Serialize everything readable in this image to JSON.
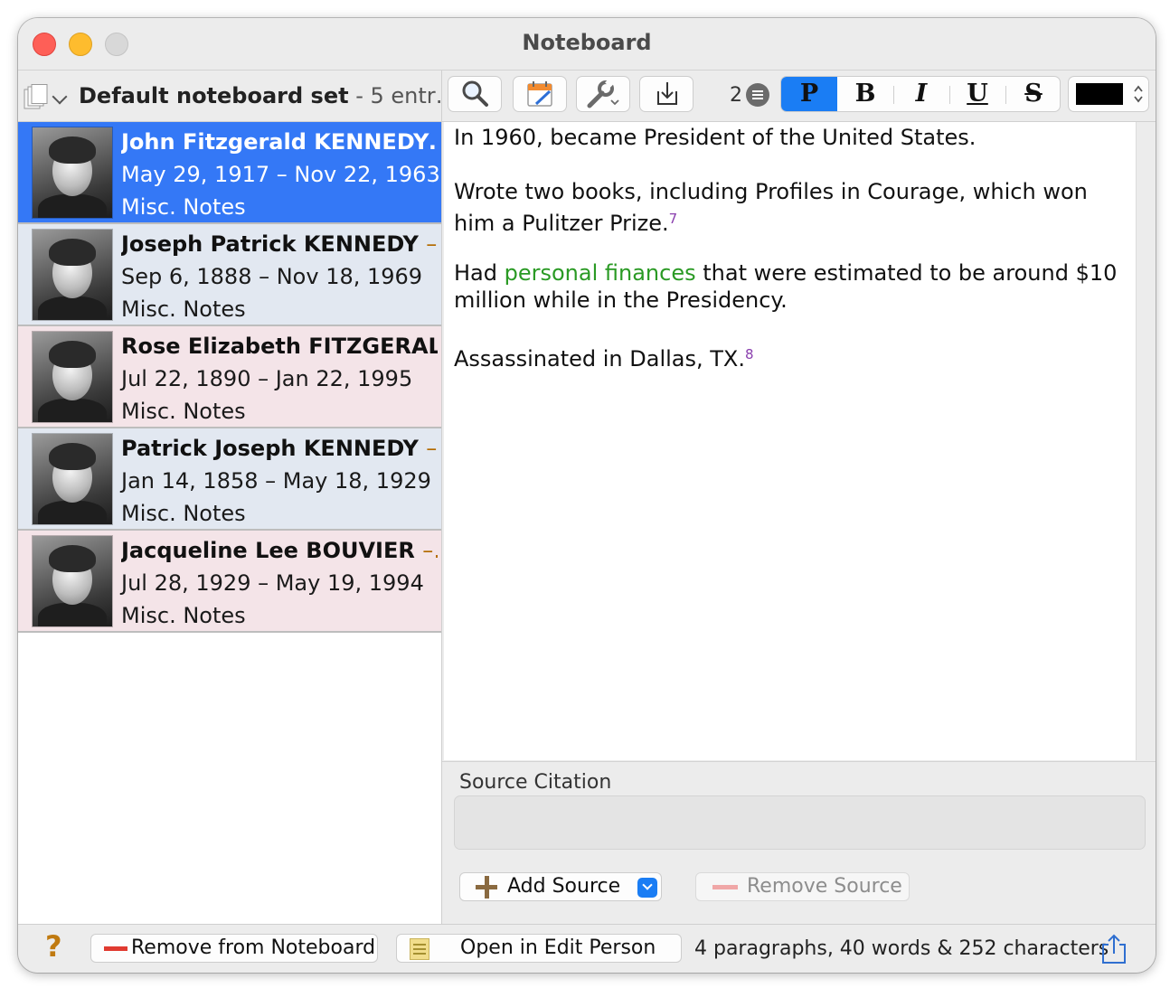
{
  "window": {
    "title": "Noteboard"
  },
  "noteboard_set": {
    "name": "Default noteboard set",
    "count": " - 5 entr…"
  },
  "people": [
    {
      "name": "John Fitzgerald KENNEDY…",
      "dash": "",
      "dates": "May 29, 1917 – Nov 22, 1963",
      "notes": "Misc. Notes",
      "style": "selected"
    },
    {
      "name": "Joseph Patrick KENNEDY ",
      "dash": "–…",
      "dates": "Sep 6, 1888 – Nov 18, 1969",
      "notes": "Misc. Notes",
      "style": "blue"
    },
    {
      "name": "Rose Elizabeth FITZGERAL…",
      "dash": "",
      "dates": "Jul 22, 1890 – Jan 22, 1995",
      "notes": "Misc. Notes",
      "style": "pink"
    },
    {
      "name": "Patrick Joseph KENNEDY ",
      "dash": "–…",
      "dates": "Jan 14, 1858 – May 18, 1929",
      "notes": "Misc. Notes",
      "style": "blue"
    },
    {
      "name": "Jacqueline Lee BOUVIER ",
      "dash": "–…",
      "dates": "Jul 28, 1929 – May 19, 1994",
      "notes": "Misc. Notes",
      "style": "pink"
    }
  ],
  "toolbar": {
    "paragraph_count": "2",
    "format_buttons": [
      "P",
      "B",
      "I",
      "U",
      "S"
    ],
    "text_color": "#000000"
  },
  "note": {
    "p1": "In 1960, became President of the United States.",
    "p2": "Wrote two books, including Profiles in Courage, which won him a Pulitzer Prize.",
    "p2_footnote": "7",
    "p3_before": "Had ",
    "p3_link": "personal finances",
    "p3_after": " that were estimated to be around $10 million while in the Presidency.",
    "p4": "Assassinated in Dallas, TX.",
    "p4_footnote": "8"
  },
  "citation": {
    "label": "Source Citation",
    "add_source": "Add Source",
    "remove_source": "Remove Source"
  },
  "bottom": {
    "help": "?",
    "remove_label": "Remove from Noteboard",
    "open_label": "Open in Edit Person",
    "stats": "4 paragraphs, 40 words & 252 characters"
  },
  "colors": {
    "accent": "#1a7df4",
    "selected_row": "#3478f6",
    "link_green": "#2a9a24",
    "footnote": "#8a3fae"
  }
}
